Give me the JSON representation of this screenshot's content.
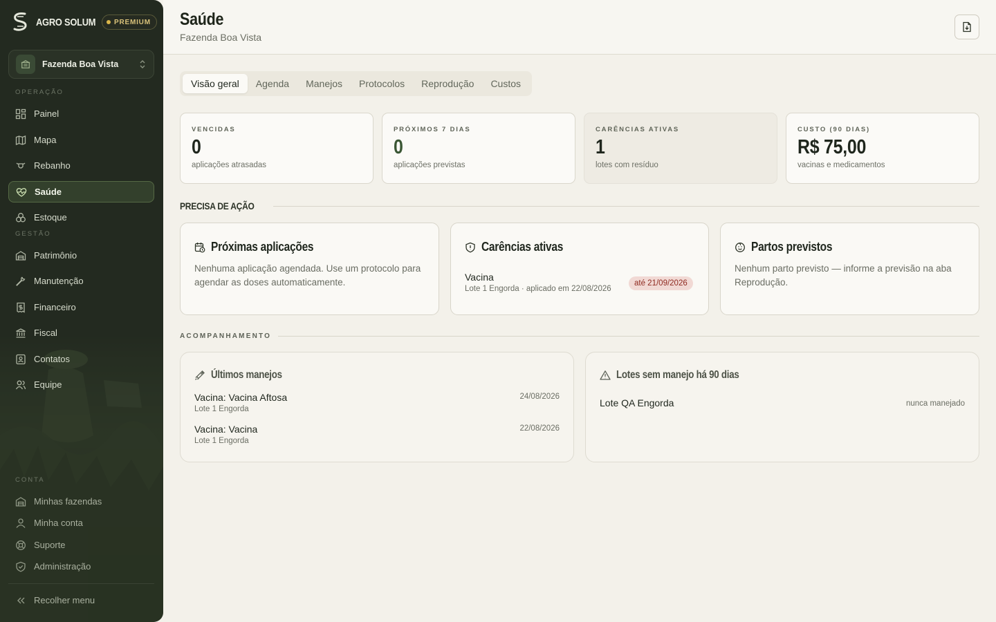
{
  "sidebar": {
    "brand": "AGRO SOLUM",
    "premium": "PREMIUM",
    "farm": "Fazenda Boa Vista",
    "sections": {
      "operacao": "OPERAÇÃO",
      "gestao": "GESTÃO",
      "conta": "CONTA"
    },
    "operacao": [
      {
        "label": "Painel",
        "icon": "dashboard-icon"
      },
      {
        "label": "Mapa",
        "icon": "map-icon"
      },
      {
        "label": "Rebanho",
        "icon": "cattle-icon"
      },
      {
        "label": "Saúde",
        "icon": "heart-pulse-icon",
        "active": true
      },
      {
        "label": "Estoque",
        "icon": "boxes-icon"
      }
    ],
    "gestao": [
      {
        "label": "Patrimônio",
        "icon": "building-icon"
      },
      {
        "label": "Manutenção",
        "icon": "wrench-icon"
      },
      {
        "label": "Financeiro",
        "icon": "dollar-receipt-icon"
      },
      {
        "label": "Fiscal",
        "icon": "bank-icon"
      },
      {
        "label": "Contatos",
        "icon": "contact-card-icon"
      },
      {
        "label": "Equipe",
        "icon": "users-icon"
      }
    ],
    "conta": [
      {
        "label": "Minhas fazendas",
        "icon": "warehouse-icon"
      },
      {
        "label": "Minha conta",
        "icon": "user-icon"
      },
      {
        "label": "Suporte",
        "icon": "lifebuoy-icon"
      },
      {
        "label": "Administração",
        "icon": "shield-check-icon"
      }
    ],
    "collapse": "Recolher menu"
  },
  "header": {
    "title": "Saúde",
    "subtitle": "Fazenda Boa Vista",
    "export_icon": "file-download-icon"
  },
  "tabs": [
    "Visão geral",
    "Agenda",
    "Manejos",
    "Protocolos",
    "Reprodução",
    "Custos"
  ],
  "stats": [
    {
      "label": "VENCIDAS",
      "value": "0",
      "desc": "aplicações atrasadas"
    },
    {
      "label": "PRÓXIMOS 7 DIAS",
      "value": "0",
      "desc": "aplicações previstas"
    },
    {
      "label": "CARÊNCIAS ATIVAS",
      "value": "1",
      "desc": "lotes com resíduo"
    },
    {
      "label": "CUSTO (90 DIAS)",
      "value": "R$ 75,00",
      "desc": "vacinas e medicamentos"
    }
  ],
  "action_section": "PRECISA DE AÇÃO",
  "action_cards": {
    "proximas": {
      "title": "Próximas aplicações",
      "body": "Nenhuma aplicação agendada. Use um protocolo para agendar as doses automaticamente."
    },
    "carencias": {
      "title": "Carências ativas",
      "item": "Vacina",
      "sub": "Lote 1 Engorda · aplicado em 22/08/2026",
      "badge": "até 21/09/2026"
    },
    "partos": {
      "title": "Partos previstos",
      "body": "Nenhum parto previsto — informe a previsão na aba Reprodução."
    }
  },
  "follow_section": "ACOMPANHAMENTO",
  "ultimos": {
    "title": "Últimos manejos",
    "rows": [
      {
        "name": "Vacina: Vacina Aftosa",
        "lote": "Lote 1 Engorda",
        "date": "24/08/2026"
      },
      {
        "name": "Vacina: Vacina",
        "lote": "Lote 1 Engorda",
        "date": "22/08/2026"
      }
    ]
  },
  "sem_manejo": {
    "title": "Lotes sem manejo há 90 dias",
    "rows": [
      {
        "name": "Lote QA Engorda",
        "status": "nunca manejado"
      }
    ]
  },
  "colors": {
    "sidebar": "#232a20",
    "accent": "#3a5634",
    "danger_badge": "#f1d9d4",
    "premium": "#d9b64a"
  }
}
